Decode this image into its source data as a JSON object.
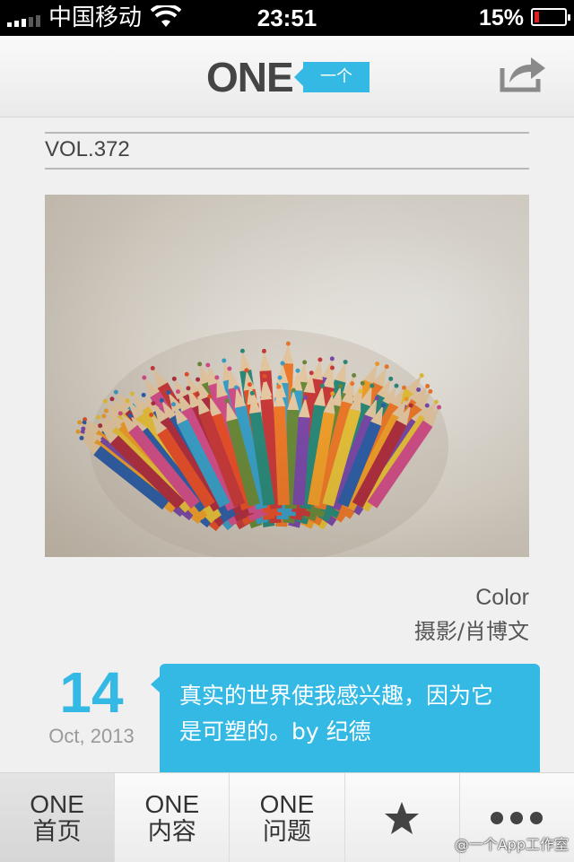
{
  "status_bar": {
    "carrier": "中国移动",
    "time": "23:51",
    "battery_percent_text": "15%",
    "battery_level": 0.15,
    "battery_fill_color": "#e02020",
    "signal_icon": "signal-bars-icon",
    "wifi_icon": "wifi-icon"
  },
  "header": {
    "logo_text": "ONE",
    "logo_tag": "一个",
    "accent_color": "#33b9e4",
    "share_icon": "share-icon"
  },
  "issue": {
    "volume": "VOL.372"
  },
  "photo": {
    "description_icon": "colored-pencils-photo",
    "title": "Color",
    "credit": "摄影/肖博文"
  },
  "date": {
    "day": "14",
    "month_year": "Oct, 2013"
  },
  "quote": {
    "line1": "真实的世界使我感兴趣，因为它",
    "line2": "是可塑的。by 纪德"
  },
  "tabbar": {
    "tabs": [
      {
        "top": "ONE",
        "bottom": "首页",
        "active": true
      },
      {
        "top": "ONE",
        "bottom": "内容",
        "active": false
      },
      {
        "top": "ONE",
        "bottom": "问题",
        "active": false
      },
      {
        "icon": "star-icon",
        "active": false
      },
      {
        "icon": "more-dots-icon",
        "active": false
      }
    ]
  },
  "watermark": "@一个App工作室"
}
